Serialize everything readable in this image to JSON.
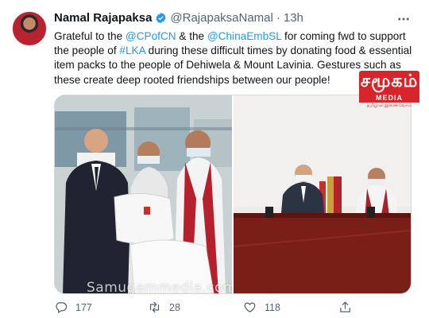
{
  "tweet": {
    "name": "Namal Rajapaksa",
    "handle": "@RajapaksaNamal",
    "separator": "·",
    "time": "13h",
    "text_parts": [
      "Grateful to the ",
      "@CPofCN",
      " & the ",
      "@ChinaEmbSL",
      " for coming fwd to support the people of ",
      "#LKA",
      " during these difficult times by donating food & essential item packs to the people of Dehiwela & Mount Lavinia. Gestures such as these create deep rooted friendships between our people!"
    ]
  },
  "media": {
    "watermark": "Samugammedia.com",
    "badge": {
      "title": "சமூகம்",
      "media": "MEDIA",
      "sub": "தமிழால் இணைவோம்"
    }
  },
  "actions": {
    "replies": "177",
    "retweets": "28",
    "likes": "118"
  },
  "colors": {
    "link": "#1d9bf0",
    "verified": "#1d9bf0",
    "muted": "#536471",
    "badge": "#d7252b"
  },
  "icons": [
    "verified-badge-icon",
    "more-icon",
    "reply-icon",
    "retweet-icon",
    "like-icon",
    "share-icon"
  ]
}
